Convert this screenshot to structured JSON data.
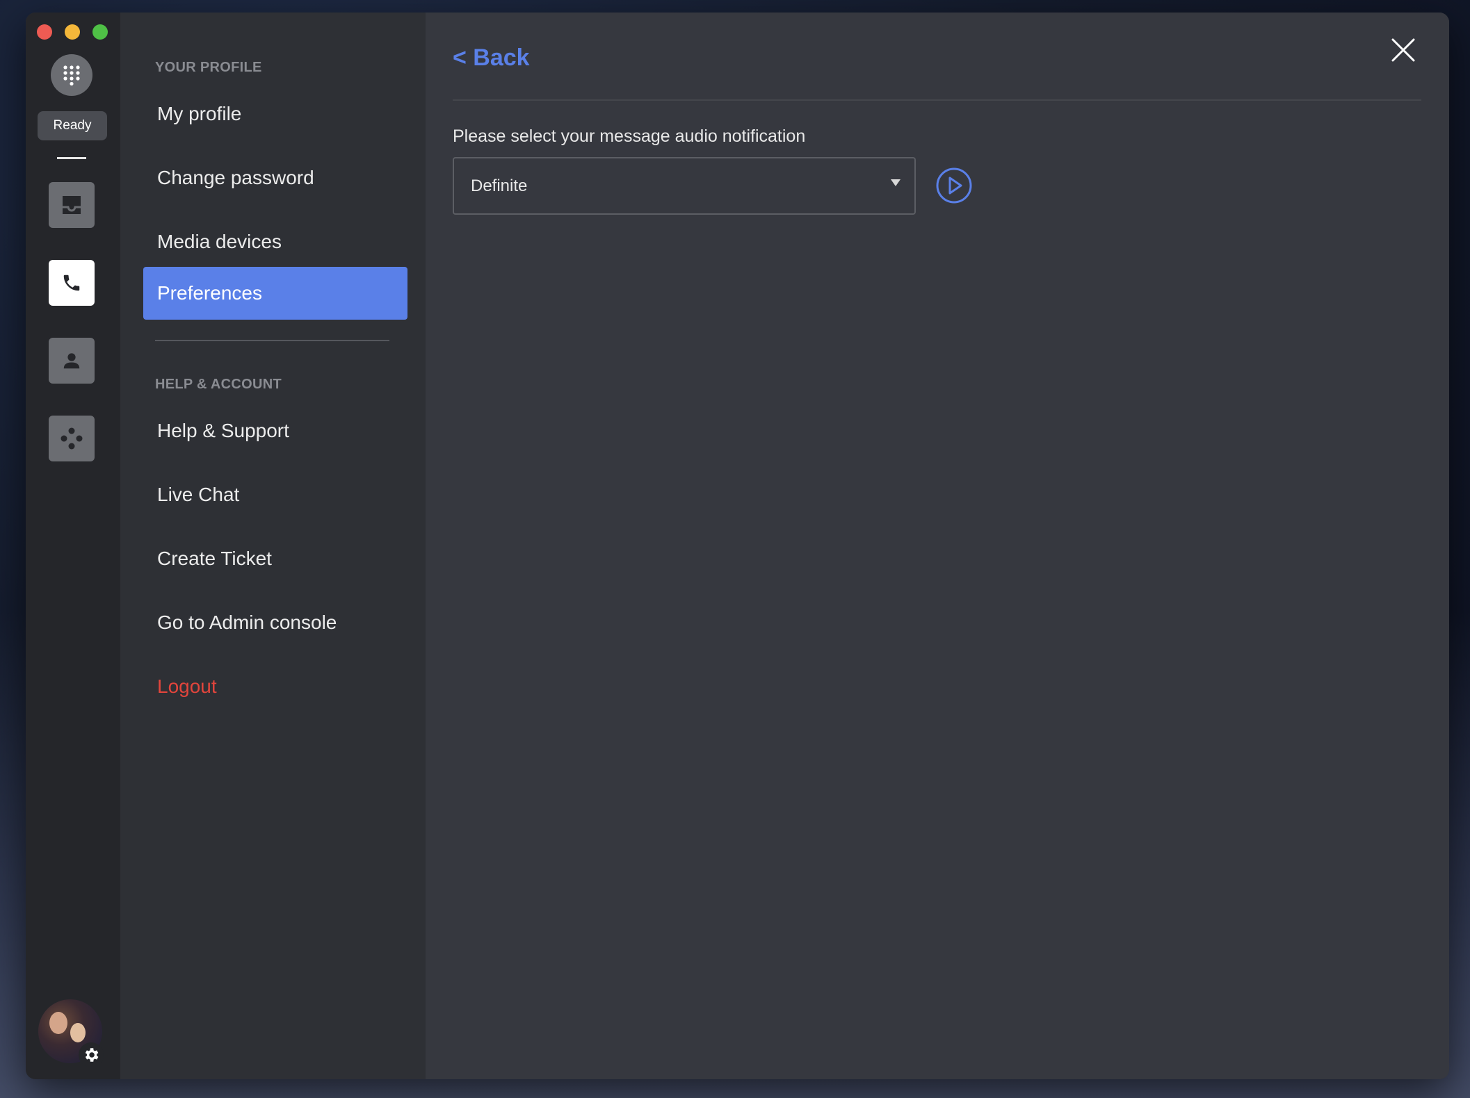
{
  "app": {
    "status": "Ready",
    "accent_color": "#5a80e8",
    "danger_color": "#e2453c"
  },
  "rail": {
    "icons": [
      "dialpad-icon",
      "inbox-icon",
      "phone-icon",
      "contact-icon",
      "integrations-icon"
    ],
    "active": "phone-icon"
  },
  "nav": {
    "profile_section": "YOUR PROFILE",
    "profile_items": [
      {
        "label": "My profile"
      },
      {
        "label": "Change password"
      },
      {
        "label": "Media devices"
      },
      {
        "label": "Preferences",
        "active": true
      }
    ],
    "help_section": "HELP & ACCOUNT",
    "help_items": [
      {
        "label": "Help & Support"
      },
      {
        "label": "Live Chat"
      },
      {
        "label": "Create Ticket"
      },
      {
        "label": "Go to Admin console"
      },
      {
        "label": "Logout",
        "danger": true
      }
    ]
  },
  "main": {
    "back_label": "< Back",
    "field_label": "Please select your message audio notification",
    "selected_sound": "Definite"
  }
}
